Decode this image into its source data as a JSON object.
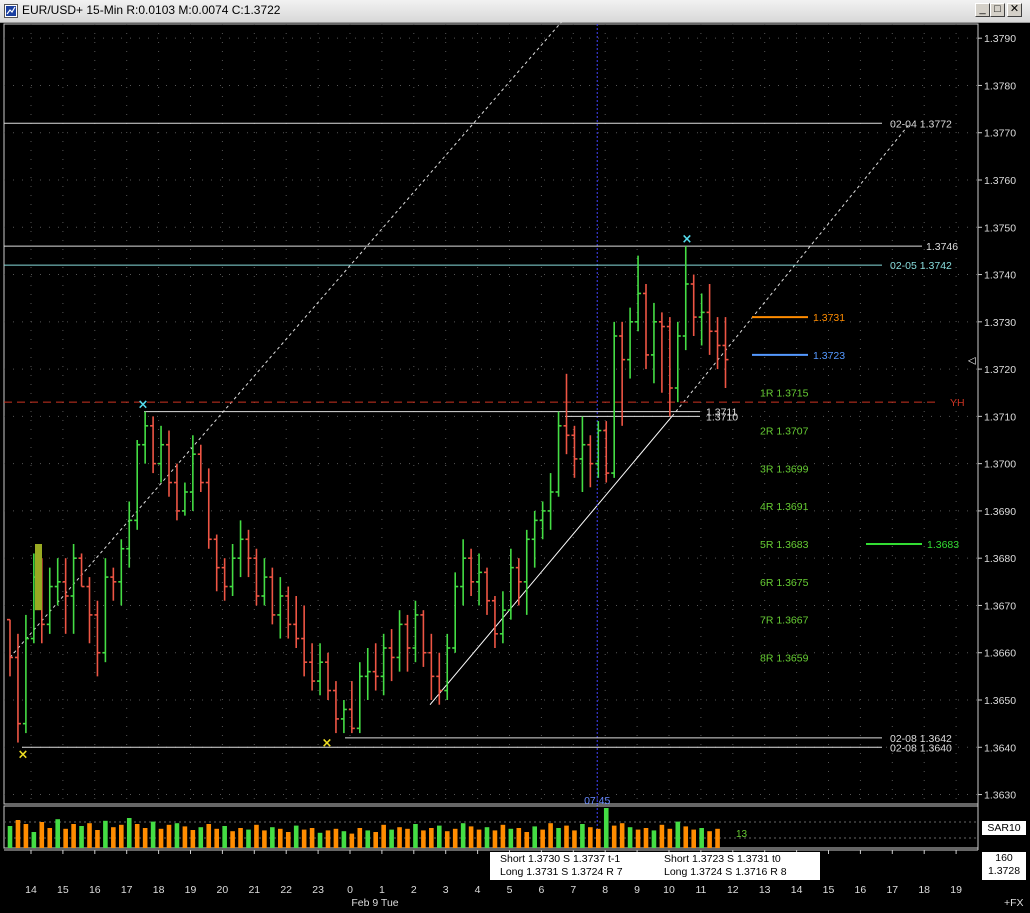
{
  "window": {
    "title": "EUR/USD+ 15-Min R:0.0103 M:0.0074 C:1.3722",
    "minimize_glyph": "_",
    "maximize_glyph": "□",
    "close_glyph": "✕",
    "icon": "chart-window-icon"
  },
  "colors": {
    "background": "#000000",
    "up_bar": "#44dd44",
    "down_bar": "#ee5544",
    "grid": "#555555",
    "level_white": "#dddddd",
    "level_cyan": "#88dddd",
    "yh_line": "#cc3322",
    "pivot_text": "#66cc33",
    "orange": "#ff8c00",
    "blue": "#5599ff",
    "green_line": "#33dd33",
    "cursor": "#4444ff"
  },
  "chart_data": {
    "type": "bar",
    "subtype": "ohlc",
    "symbol": "EUR/USD+",
    "interval": "15-Min",
    "ylim": [
      1.3628,
      1.3793
    ],
    "y_ticks": [
      1.363,
      1.364,
      1.365,
      1.366,
      1.367,
      1.368,
      1.369,
      1.37,
      1.371,
      1.372,
      1.373,
      1.374,
      1.375,
      1.376,
      1.377,
      1.378,
      1.379
    ],
    "y_tick_labels": [
      "1.3630",
      "1.3640",
      "1.3650",
      "1.3660",
      "1.3670",
      "1.3680",
      "1.3690",
      "1.3700",
      "1.3710",
      "1.3720",
      "1.3730",
      "1.3740",
      "1.3750",
      "1.3760",
      "1.3770",
      "1.3780",
      "1.3790"
    ],
    "x_hours": [
      13.6,
      25.5
    ],
    "x_ticks": [
      14,
      15,
      16,
      17,
      18,
      19,
      20,
      21,
      22,
      23,
      24,
      25,
      26,
      27,
      28,
      29,
      30,
      31,
      32,
      33,
      34,
      35,
      36,
      37,
      38,
      39,
      40,
      41,
      42,
      43
    ],
    "x_tick_labels": [
      "14",
      "15",
      "16",
      "17",
      "18",
      "19",
      "20",
      "21",
      "22",
      "23",
      "0",
      "1",
      "2",
      "3",
      "4",
      "5",
      "6",
      "7",
      "8",
      "9",
      "10",
      "11",
      "12",
      "13",
      "14",
      "15",
      "16",
      "17",
      "18",
      "19"
    ],
    "date_label": "Feb 9 Tue",
    "cursor_time_label": "07:45",
    "cursor_hour": 31.75,
    "ohlc": [
      [
        1.3667,
        1.3667,
        1.3655,
        1.3659
      ],
      [
        1.3659,
        1.3664,
        1.3641,
        1.3645
      ],
      [
        1.3645,
        1.3668,
        1.3643,
        1.3663
      ],
      [
        1.3663,
        1.3681,
        1.3662,
        1.3676
      ],
      [
        1.3676,
        1.368,
        1.3662,
        1.3666
      ],
      [
        1.3666,
        1.3678,
        1.3664,
        1.3674
      ],
      [
        1.3674,
        1.368,
        1.367,
        1.3675
      ],
      [
        1.3675,
        1.368,
        1.3664,
        1.3672
      ],
      [
        1.3672,
        1.3683,
        1.3664,
        1.368
      ],
      [
        1.368,
        1.3681,
        1.3674,
        1.3674
      ],
      [
        1.3674,
        1.3676,
        1.3662,
        1.3668
      ],
      [
        1.3668,
        1.3671,
        1.3655,
        1.366
      ],
      [
        1.366,
        1.368,
        1.3658,
        1.3676
      ],
      [
        1.3676,
        1.3678,
        1.3671,
        1.3675
      ],
      [
        1.3675,
        1.3684,
        1.367,
        1.3682
      ],
      [
        1.3682,
        1.3692,
        1.3678,
        1.3688
      ],
      [
        1.3688,
        1.3705,
        1.3686,
        1.3704
      ],
      [
        1.3704,
        1.3711,
        1.37,
        1.3708
      ],
      [
        1.3708,
        1.371,
        1.3698,
        1.37
      ],
      [
        1.37,
        1.3708,
        1.3696,
        1.3704
      ],
      [
        1.3704,
        1.3707,
        1.3693,
        1.3696
      ],
      [
        1.3696,
        1.37,
        1.3688,
        1.369
      ],
      [
        1.369,
        1.3696,
        1.3689,
        1.3694
      ],
      [
        1.3694,
        1.3706,
        1.369,
        1.3702
      ],
      [
        1.3702,
        1.3704,
        1.3694,
        1.3696
      ],
      [
        1.3696,
        1.3699,
        1.3682,
        1.3684
      ],
      [
        1.3684,
        1.3685,
        1.3673,
        1.3678
      ],
      [
        1.3678,
        1.368,
        1.3671,
        1.3674
      ],
      [
        1.3674,
        1.3683,
        1.3672,
        1.368
      ],
      [
        1.368,
        1.3688,
        1.3676,
        1.3684
      ],
      [
        1.3684,
        1.3686,
        1.3676,
        1.368
      ],
      [
        1.368,
        1.3682,
        1.367,
        1.3672
      ],
      [
        1.3672,
        1.368,
        1.367,
        1.3676
      ],
      [
        1.3676,
        1.3678,
        1.3666,
        1.3668
      ],
      [
        1.3668,
        1.3676,
        1.3663,
        1.3672
      ],
      [
        1.3672,
        1.3674,
        1.3663,
        1.3666
      ],
      [
        1.3666,
        1.3672,
        1.3661,
        1.3663
      ],
      [
        1.3663,
        1.367,
        1.3655,
        1.3658
      ],
      [
        1.3658,
        1.3662,
        1.3652,
        1.3654
      ],
      [
        1.3654,
        1.3662,
        1.3651,
        1.3658
      ],
      [
        1.3658,
        1.366,
        1.365,
        1.3652
      ],
      [
        1.3652,
        1.3654,
        1.3643,
        1.3646
      ],
      [
        1.3646,
        1.365,
        1.3643,
        1.3648
      ],
      [
        1.3648,
        1.3654,
        1.3643,
        1.3644
      ],
      [
        1.3644,
        1.3658,
        1.3643,
        1.3655
      ],
      [
        1.3655,
        1.3661,
        1.365,
        1.3656
      ],
      [
        1.3656,
        1.3662,
        1.3652,
        1.3655
      ],
      [
        1.3655,
        1.3664,
        1.3651,
        1.3661
      ],
      [
        1.3661,
        1.3665,
        1.3654,
        1.3659
      ],
      [
        1.3659,
        1.3669,
        1.3656,
        1.3666
      ],
      [
        1.3666,
        1.3668,
        1.3656,
        1.3661
      ],
      [
        1.3661,
        1.3671,
        1.3658,
        1.3668
      ],
      [
        1.3668,
        1.3669,
        1.3657,
        1.366
      ],
      [
        1.366,
        1.3664,
        1.365,
        1.3655
      ],
      [
        1.3655,
        1.366,
        1.3649,
        1.3652
      ],
      [
        1.3652,
        1.3664,
        1.365,
        1.3661
      ],
      [
        1.3661,
        1.3677,
        1.366,
        1.3674
      ],
      [
        1.3674,
        1.3684,
        1.367,
        1.368
      ],
      [
        1.368,
        1.3682,
        1.3672,
        1.3675
      ],
      [
        1.3675,
        1.3681,
        1.367,
        1.3677
      ],
      [
        1.3677,
        1.3678,
        1.3668,
        1.3671
      ],
      [
        1.3671,
        1.3672,
        1.3661,
        1.3664
      ],
      [
        1.3664,
        1.3673,
        1.3662,
        1.3669
      ],
      [
        1.3669,
        1.3682,
        1.3667,
        1.3678
      ],
      [
        1.3678,
        1.368,
        1.367,
        1.3675
      ],
      [
        1.3675,
        1.3686,
        1.3668,
        1.3684
      ],
      [
        1.3684,
        1.369,
        1.3678,
        1.3688
      ],
      [
        1.3688,
        1.3692,
        1.3684,
        1.369
      ],
      [
        1.369,
        1.3698,
        1.3686,
        1.3694
      ],
      [
        1.3694,
        1.3711,
        1.3693,
        1.3708
      ],
      [
        1.3708,
        1.3719,
        1.3702,
        1.3706
      ],
      [
        1.3706,
        1.3708,
        1.3697,
        1.3701
      ],
      [
        1.3701,
        1.371,
        1.3694,
        1.3704
      ],
      [
        1.3704,
        1.3706,
        1.3695,
        1.37
      ],
      [
        1.37,
        1.3709,
        1.3697,
        1.3707
      ],
      [
        1.3707,
        1.3709,
        1.3696,
        1.3698
      ],
      [
        1.3698,
        1.373,
        1.3697,
        1.3727
      ],
      [
        1.3727,
        1.373,
        1.3708,
        1.3722
      ],
      [
        1.3722,
        1.3733,
        1.3718,
        1.373
      ],
      [
        1.373,
        1.3744,
        1.3728,
        1.3736
      ],
      [
        1.3736,
        1.3738,
        1.372,
        1.3723
      ],
      [
        1.3723,
        1.3734,
        1.3717,
        1.373
      ],
      [
        1.373,
        1.3732,
        1.3715,
        1.3729
      ],
      [
        1.3729,
        1.3731,
        1.371,
        1.3716
      ],
      [
        1.3716,
        1.373,
        1.3713,
        1.3727
      ],
      [
        1.3727,
        1.3746,
        1.3724,
        1.3738
      ],
      [
        1.3738,
        1.374,
        1.3727,
        1.3731
      ],
      [
        1.3731,
        1.3736,
        1.3725,
        1.3732
      ],
      [
        1.3732,
        1.3738,
        1.3723,
        1.3728
      ],
      [
        1.3728,
        1.3731,
        1.372,
        1.3725
      ],
      [
        1.3725,
        1.3731,
        1.3716,
        1.3722
      ]
    ],
    "highs_marked": [
      1.3711,
      1.3746
    ],
    "lows_marked": [
      1.364,
      1.3642
    ],
    "levels": [
      {
        "label": "02-04  1.3772",
        "price": 1.3772
      },
      {
        "label": "1.3746",
        "price": 1.3746
      },
      {
        "label": "02-05  1.3742",
        "price": 1.3742
      },
      {
        "label": "YH",
        "price": 1.3713
      },
      {
        "label": "1.3711",
        "price": 1.3711
      },
      {
        "label": "1.3710",
        "price": 1.371
      },
      {
        "label": "02-08  1.3642",
        "price": 1.3642
      },
      {
        "label": "02-08  1.3640",
        "price": 1.364
      }
    ],
    "marker_lines": [
      {
        "label": "1.3731",
        "price": 1.3731,
        "color": "orange"
      },
      {
        "label": "1.3723",
        "price": 1.3723,
        "color": "blue"
      },
      {
        "label": "1.3683",
        "price": 1.3683,
        "color": "green"
      }
    ],
    "pivots": [
      {
        "label": "1R 1.3715",
        "price": 1.3715
      },
      {
        "label": "2R 1.3707",
        "price": 1.3707
      },
      {
        "label": "3R 1.3699",
        "price": 1.3699
      },
      {
        "label": "4R 1.3691",
        "price": 1.3691
      },
      {
        "label": "5R 1.3683",
        "price": 1.3683
      },
      {
        "label": "6R 1.3675",
        "price": 1.3675
      },
      {
        "label": "7R 1.3667",
        "price": 1.3667
      },
      {
        "label": "8R 1.3659",
        "price": 1.3659
      }
    ],
    "volume": [
      55,
      70,
      60,
      40,
      65,
      50,
      72,
      48,
      60,
      55,
      62,
      45,
      68,
      52,
      58,
      75,
      60,
      50,
      66,
      48,
      58,
      62,
      54,
      45,
      52,
      60,
      48,
      55,
      42,
      50,
      46,
      58,
      44,
      52,
      48,
      40,
      56,
      46,
      50,
      38,
      44,
      48,
      42,
      36,
      50,
      44,
      40,
      58,
      46,
      52,
      48,
      60,
      44,
      50,
      56,
      42,
      48,
      62,
      54,
      46,
      52,
      44,
      58,
      48,
      50,
      40,
      54,
      46,
      62,
      50,
      56,
      44,
      60,
      52,
      48,
      100,
      56,
      62,
      52,
      46,
      50,
      44,
      58,
      48,
      66,
      54,
      46,
      50,
      42,
      48
    ],
    "volume_label": "13",
    "indicator": "SAR10"
  },
  "summary": {
    "short1": "Short 1.3730   S 1.3737   t-1",
    "long1": "Long 1.3731   S 1.3724   R 7",
    "short2": "Short 1.3723   S 1.3731   t0",
    "long2": "Long 1.3724   S 1.3716   R 8"
  },
  "price_box": {
    "top": "160",
    "bottom": "1.3728"
  },
  "symbol_corner": "+FX",
  "right_axis_cursor_arrow": "◁"
}
